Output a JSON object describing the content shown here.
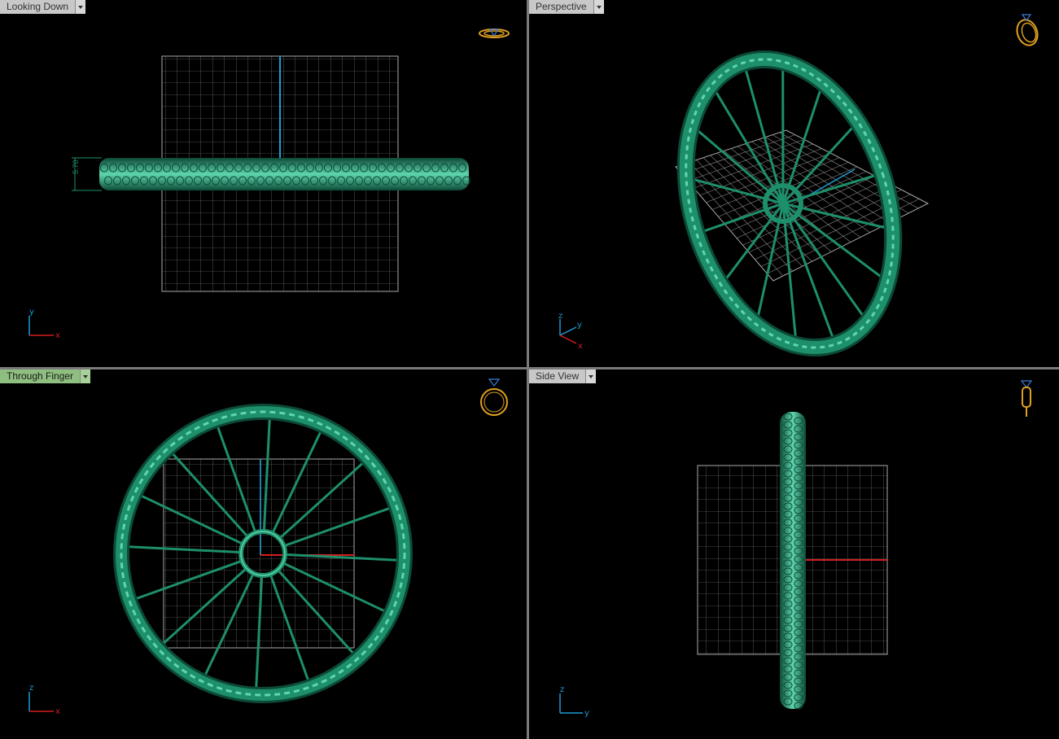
{
  "viewports": [
    {
      "id": "top",
      "title": "Looking Down",
      "active": false,
      "triad": [
        "y",
        "x"
      ],
      "dimension": "5.70"
    },
    {
      "id": "persp",
      "title": "Perspective",
      "active": false,
      "triad": [
        "z",
        "y",
        "x"
      ]
    },
    {
      "id": "front",
      "title": "Through Finger",
      "active": true,
      "triad": [
        "z",
        "x"
      ]
    },
    {
      "id": "side",
      "title": "Side View",
      "active": false,
      "triad": [
        "z",
        "y"
      ]
    }
  ],
  "colors": {
    "ring": "#1d8f6b",
    "ring_light": "#5fd6ae",
    "ring_dark": "#0c4a37",
    "grid": "#8a8a8a",
    "axis_x": "#d21e1e",
    "axis_y": "#1e9bd2",
    "axis_z": "#1e9bd2",
    "ring_icon": "#e0a020",
    "gem_icon": "#3a7bd5",
    "active_tab": "#8fbf80"
  },
  "icons": {
    "top": "ring-top-icon",
    "persp": "ring-perspective-icon",
    "front": "ring-front-icon",
    "side": "ring-side-icon"
  }
}
